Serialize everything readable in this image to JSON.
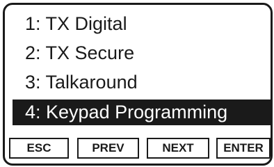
{
  "menu": {
    "items": [
      {
        "label": "1: TX Digital"
      },
      {
        "label": "2: TX Secure"
      },
      {
        "label": "3: Talkaround"
      },
      {
        "label": "4: Keypad Programming",
        "selected": true
      }
    ]
  },
  "softkeys": {
    "esc": "ESC",
    "prev": "PREV",
    "next": "NEXT",
    "enter": "ENTER"
  },
  "colors": {
    "foreground": "#1a1a1a",
    "background": "#ffffff",
    "highlight": "#1a1a1a"
  }
}
